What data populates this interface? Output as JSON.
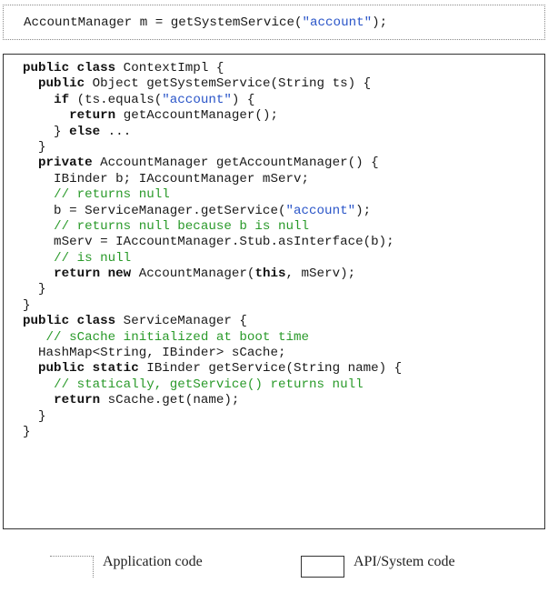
{
  "app_code": {
    "line": [
      {
        "t": "AccountManager m = getSystemService(",
        "c": ""
      },
      {
        "t": "\"account\"",
        "c": "str"
      },
      {
        "t": ");",
        "c": ""
      }
    ]
  },
  "system_code": {
    "lines": [
      [
        {
          "t": "public class",
          "c": "kw"
        },
        {
          "t": " ContextImpl {",
          "c": ""
        }
      ],
      [
        {
          "t": "  ",
          "c": ""
        },
        {
          "t": "public",
          "c": "kw"
        },
        {
          "t": " Object getSystemService(String ts) {",
          "c": ""
        }
      ],
      [
        {
          "t": "    ",
          "c": ""
        },
        {
          "t": "if",
          "c": "kw"
        },
        {
          "t": " (ts.equals(",
          "c": ""
        },
        {
          "t": "\"account\"",
          "c": "str"
        },
        {
          "t": ") {",
          "c": ""
        }
      ],
      [
        {
          "t": "      ",
          "c": ""
        },
        {
          "t": "return",
          "c": "kw"
        },
        {
          "t": " getAccountManager();",
          "c": ""
        }
      ],
      [
        {
          "t": "    } ",
          "c": ""
        },
        {
          "t": "else",
          "c": "kw"
        },
        {
          "t": " ...",
          "c": ""
        }
      ],
      [
        {
          "t": "  }",
          "c": ""
        }
      ],
      [
        {
          "t": "  ",
          "c": ""
        },
        {
          "t": "private",
          "c": "kw"
        },
        {
          "t": " AccountManager getAccountManager() {",
          "c": ""
        }
      ],
      [
        {
          "t": "    IBinder b; IAccountManager mServ;",
          "c": ""
        }
      ],
      [
        {
          "t": "    ",
          "c": ""
        },
        {
          "t": "// returns null",
          "c": "cm"
        }
      ],
      [
        {
          "t": "    b = ServiceManager.getService(",
          "c": ""
        },
        {
          "t": "\"account\"",
          "c": "str"
        },
        {
          "t": ");",
          "c": ""
        }
      ],
      [
        {
          "t": "    ",
          "c": ""
        },
        {
          "t": "// returns null because b is null",
          "c": "cm"
        }
      ],
      [
        {
          "t": "    mServ = IAccountManager.Stub.asInterface(b);",
          "c": ""
        }
      ],
      [
        {
          "t": "    ",
          "c": ""
        },
        {
          "t": "// is null",
          "c": "cm"
        }
      ],
      [
        {
          "t": "    ",
          "c": ""
        },
        {
          "t": "return new",
          "c": "kw"
        },
        {
          "t": " AccountManager(",
          "c": ""
        },
        {
          "t": "this",
          "c": "kw"
        },
        {
          "t": ", mServ);",
          "c": ""
        }
      ],
      [
        {
          "t": "  }",
          "c": ""
        }
      ],
      [
        {
          "t": "}",
          "c": ""
        }
      ],
      [
        {
          "t": "public class",
          "c": "kw"
        },
        {
          "t": " ServiceManager {",
          "c": ""
        }
      ],
      [
        {
          "t": "   ",
          "c": ""
        },
        {
          "t": "// sCache initialized at boot time",
          "c": "cm"
        }
      ],
      [
        {
          "t": "  HashMap<String, IBinder> sCache;",
          "c": ""
        }
      ],
      [
        {
          "t": "  ",
          "c": ""
        },
        {
          "t": "public static",
          "c": "kw"
        },
        {
          "t": " IBinder getService(String name) {",
          "c": ""
        }
      ],
      [
        {
          "t": "    ",
          "c": ""
        },
        {
          "t": "// statically, getService() returns null",
          "c": "cm"
        }
      ],
      [
        {
          "t": "    ",
          "c": ""
        },
        {
          "t": "return",
          "c": "kw"
        },
        {
          "t": " sCache.get(name);",
          "c": ""
        }
      ],
      [
        {
          "t": "  }",
          "c": ""
        }
      ],
      [
        {
          "t": "}",
          "c": ""
        }
      ]
    ]
  },
  "legend": {
    "app_label": "Application code",
    "system_label": "API/System code"
  }
}
